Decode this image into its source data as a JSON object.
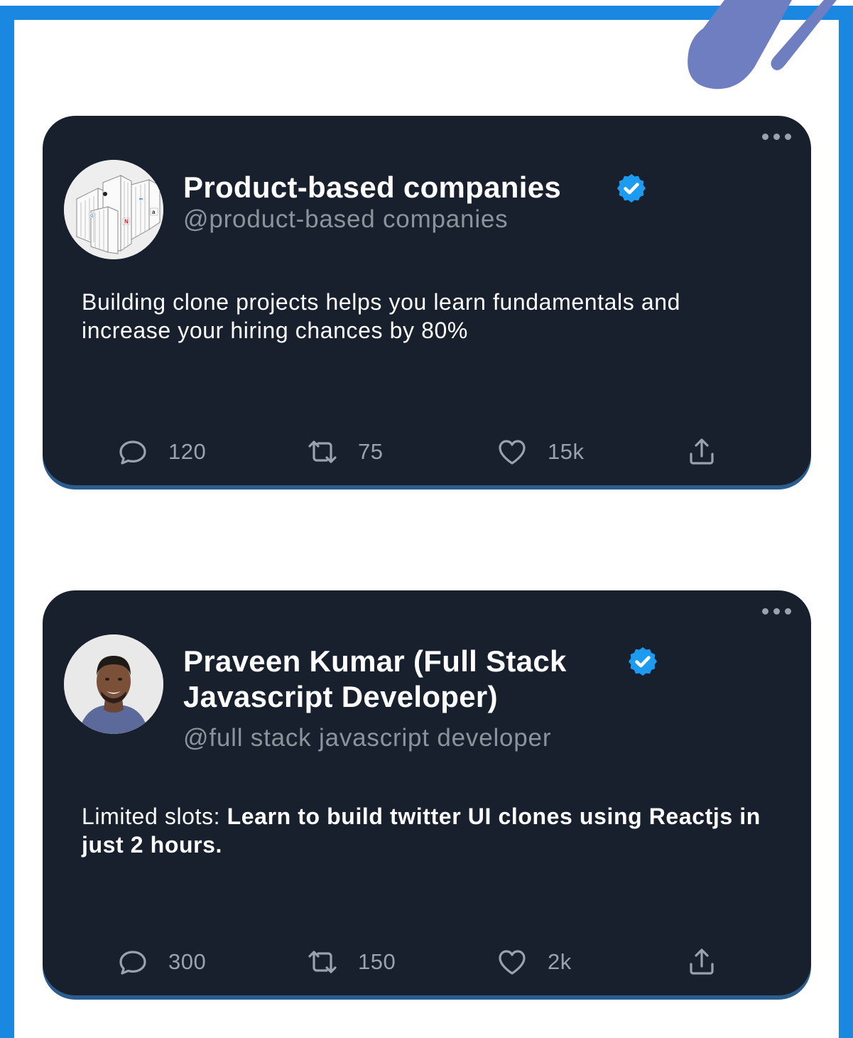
{
  "tweets": [
    {
      "name": "Product-based companies",
      "handle": "@product-based companies",
      "text_plain": "Building clone projects helps you learn fundamentals and increase your hiring chances by 80%",
      "text_bold": "",
      "replies": "120",
      "retweets": "75",
      "likes": "15k"
    },
    {
      "name": "Praveen Kumar (Full Stack Javascript Developer)",
      "handle": "@full stack javascript developer",
      "text_plain": "Limited slots: ",
      "text_bold": "Learn to build twitter UI clones using Reactjs in just 2 hours.",
      "replies": "300",
      "retweets": "150",
      "likes": "2k"
    }
  ],
  "colors": {
    "frame_border": "#1a88e0",
    "card_bg": "#17202c",
    "verified": "#1d9bf0",
    "deco": "#6f7dc1"
  },
  "icons": [
    "more-icon",
    "verified-icon",
    "reply-icon",
    "retweet-icon",
    "like-icon",
    "share-icon"
  ]
}
